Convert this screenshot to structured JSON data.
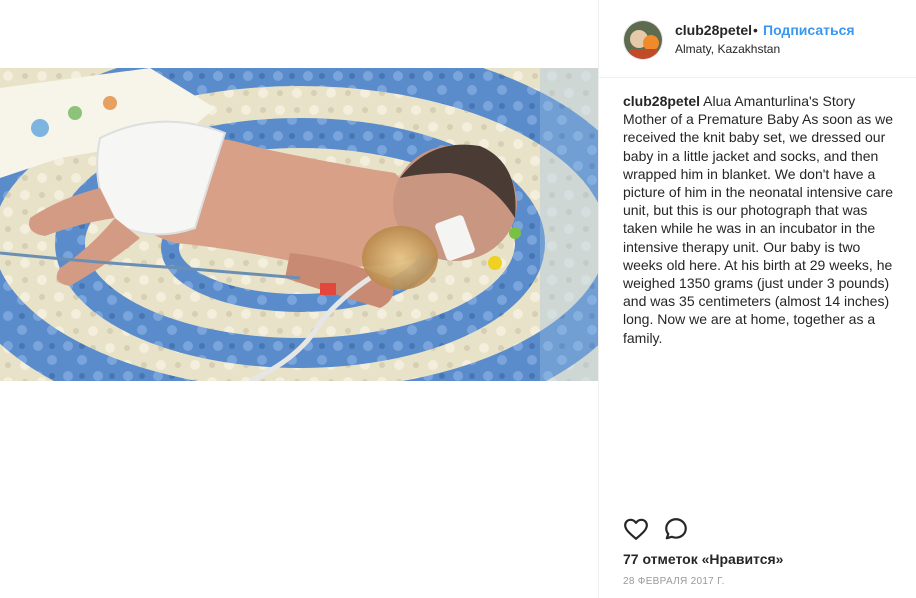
{
  "post": {
    "image_alt": "Premature baby lying on a blue and cream crocheted blanket with an oxygen mask",
    "colors": {
      "blanket_blue": "#5e8fcb",
      "blanket_cream": "#ece6cf",
      "skin": "#d79d86",
      "accent_link": "#3897f0"
    }
  },
  "header": {
    "username": "club28petel",
    "separator": "•",
    "follow_label": "Подписаться",
    "location": "Almaty, Kazakhstan",
    "avatar_icon": "avatar-photo"
  },
  "caption": {
    "username": "club28petel",
    "text": "Alua Amanturlina's Story Mother of a Premature Baby As soon as we received the knit baby set, we dressed our baby in a little jacket and socks, and then wrapped him in blanket. We don't have a picture of him in the neonatal intensive care unit, but this is our photograph that was taken while he was in an incubator in the intensive therapy unit. Our baby is two weeks old here. At his birth at 29 weeks, he weighed 1350 grams (just under 3 pounds) and was 35 centimeters (almost 14 inches) long. Now we are at home, together as a family."
  },
  "actions": {
    "like_icon": "heart-icon",
    "comment_icon": "comment-bubble-icon"
  },
  "likes": {
    "label": "77 отметок «Нравится»"
  },
  "date": {
    "label": "28 февраля 2017 г."
  }
}
